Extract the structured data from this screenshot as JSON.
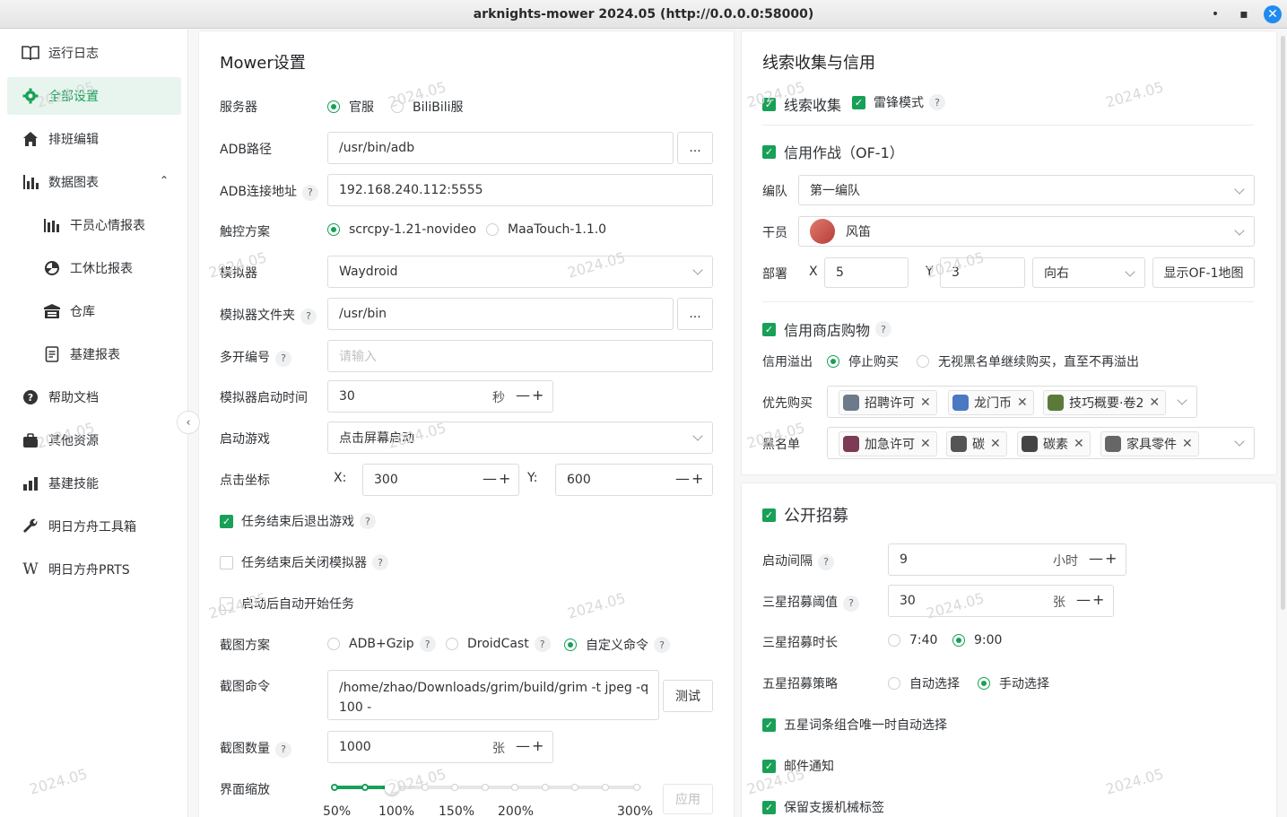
{
  "window": {
    "title": "arknights-mower 2024.05 (http://0.0.0.0:58000)",
    "min": "•",
    "max": "▪",
    "close": "✕"
  },
  "sidebar": {
    "items": [
      {
        "label": "运行日志",
        "icon": "book-icon"
      },
      {
        "label": "全部设置",
        "icon": "gear-icon",
        "active": true
      },
      {
        "label": "排班编辑",
        "icon": "home-icon"
      },
      {
        "label": "数据图表",
        "icon": "bar-chart-icon",
        "expand": "⌃"
      },
      {
        "label": "干员心情报表",
        "icon": "bar-chart-icon",
        "sub": true
      },
      {
        "label": "工休比报表",
        "icon": "pie-icon",
        "sub": true
      },
      {
        "label": "仓库",
        "icon": "warehouse-icon",
        "sub": true
      },
      {
        "label": "基建报表",
        "icon": "report-icon",
        "sub": true
      },
      {
        "label": "帮助文档",
        "icon": "help-icon"
      },
      {
        "label": "其他资源",
        "icon": "bag-icon"
      },
      {
        "label": "基建技能",
        "icon": "bar-chart-icon"
      },
      {
        "label": "明日方舟工具箱",
        "icon": "wrench-icon"
      },
      {
        "label": "明日方舟PRTS",
        "icon": "wikipedia-icon"
      }
    ],
    "collapse": "‹"
  },
  "watermark": "2024.05",
  "mower": {
    "title": "Mower设置",
    "server": {
      "label": "服务器",
      "options": [
        "官服",
        "BiliBili服"
      ],
      "selected": 0
    },
    "adb_path": {
      "label": "ADB路径",
      "value": "/usr/bin/adb",
      "btn": "..."
    },
    "adb_addr": {
      "label": "ADB连接地址",
      "value": "192.168.240.112:5555"
    },
    "touch": {
      "label": "触控方案",
      "options": [
        "scrcpy-1.21-novideo",
        "MaaTouch-1.1.0"
      ],
      "selected": 0
    },
    "emulator": {
      "label": "模拟器",
      "value": "Waydroid"
    },
    "emu_folder": {
      "label": "模拟器文件夹",
      "value": "/usr/bin",
      "btn": "..."
    },
    "multi": {
      "label": "多开编号",
      "placeholder": "请输入"
    },
    "emu_start": {
      "label": "模拟器启动时间",
      "value": "30",
      "unit": "秒"
    },
    "start_game": {
      "label": "启动游戏",
      "value": "点击屏幕启动"
    },
    "click": {
      "label": "点击坐标",
      "x_label": "X:",
      "x": "300",
      "y_label": "Y:",
      "y": "600"
    },
    "exit_game": {
      "label": "任务结束后退出游戏",
      "checked": true
    },
    "close_emu": {
      "label": "任务结束后关闭模拟器",
      "checked": false
    },
    "auto_start": {
      "label": "启动后自动开始任务",
      "checked": false
    },
    "screenshot": {
      "label": "截图方案",
      "options": [
        "ADB+Gzip",
        "DroidCast",
        "自定义命令"
      ],
      "selected": 2
    },
    "shot_cmd": {
      "label": "截图命令",
      "line1": "/home/zhao/Downloads/grim/build/grim -t jpeg -q",
      "line2": "100 -",
      "btn": "测试"
    },
    "shot_count": {
      "label": "截图数量",
      "value": "1000",
      "unit": "张"
    },
    "scale": {
      "label": "界面缩放",
      "value_percent": 100,
      "marks": [
        "50%",
        "100%",
        "150%",
        "200%",
        "300%"
      ],
      "btn": "应用"
    },
    "minus": "—",
    "plus": "+",
    "help": "?"
  },
  "clue": {
    "title": "线索收集与信用",
    "collect": {
      "label": "线索收集",
      "checked": true
    },
    "thunder": {
      "label": "雷锋模式",
      "checked": true
    },
    "credit_fight": {
      "label": "信用作战（OF-1）",
      "checked": true
    },
    "team": {
      "label": "编队",
      "value": "第一编队"
    },
    "operator": {
      "label": "干员",
      "value": "风笛"
    },
    "deploy": {
      "label": "部署",
      "x_label": "X",
      "x": "5",
      "y_label": "Y",
      "y": "3",
      "dir": "向右",
      "map_btn": "显示OF-1地图"
    },
    "shop": {
      "label": "信用商店购物",
      "checked": true
    },
    "overflow": {
      "label": "信用溢出",
      "options": [
        "停止购买",
        "无视黑名单继续购买，直至不再溢出"
      ],
      "selected": 0
    },
    "priority": {
      "label": "优先购买",
      "tags": [
        "招聘许可",
        "龙门币",
        "技巧概要·卷2"
      ]
    },
    "blacklist": {
      "label": "黑名单",
      "tags": [
        "加急许可",
        "碳",
        "碳素",
        "家具零件"
      ]
    }
  },
  "recruit": {
    "title": "公开招募",
    "checked": true,
    "interval": {
      "label": "启动间隔",
      "value": "9",
      "unit": "小时"
    },
    "threshold": {
      "label": "三星招募阈值",
      "value": "30",
      "unit": "张"
    },
    "duration": {
      "label": "三星招募时长",
      "options": [
        "7:40",
        "9:00"
      ],
      "selected": 1
    },
    "five_star": {
      "label": "五星招募策略",
      "options": [
        "自动选择",
        "手动选择"
      ],
      "selected": 1
    },
    "only_one": {
      "label": "五星词条组合唯一时自动选择",
      "checked": true
    },
    "mail": {
      "label": "邮件通知",
      "checked": true
    },
    "keep_tag": {
      "label": "保留支援机械标签",
      "checked": true
    }
  },
  "colors": {
    "accent": "#18a058",
    "close": "#1f8bf0"
  }
}
